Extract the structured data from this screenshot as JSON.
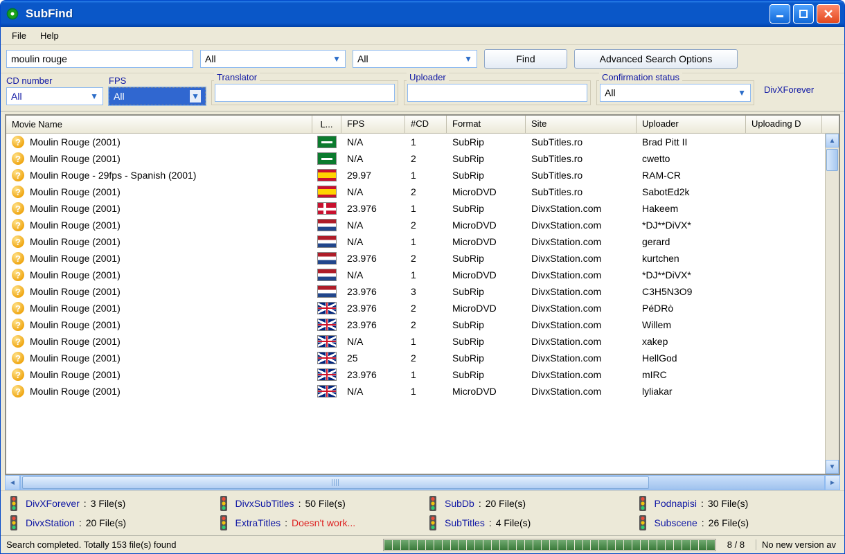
{
  "window": {
    "title": "SubFind"
  },
  "menu": {
    "file": "File",
    "help": "Help"
  },
  "search": {
    "query": "moulin rouge",
    "lang_combo": "All",
    "second_combo": "All",
    "find_btn": "Find",
    "advanced_btn": "Advanced Search Options"
  },
  "adv": {
    "cd_label": "CD number",
    "cd_value": "All",
    "fps_label": "FPS",
    "fps_value": "All",
    "translator_label": "Translator",
    "translator_value": "",
    "uploader_label": "Uploader",
    "uploader_value": "",
    "confirm_label": "Confirmation status",
    "confirm_value": "All",
    "site_link": "DivXForever"
  },
  "columns": {
    "name": "Movie Name",
    "lang": "L...",
    "fps": "FPS",
    "cd": "#CD",
    "fmt": "Format",
    "site": "Site",
    "uploader": "Uploader",
    "date": "Uploading D"
  },
  "rows": [
    {
      "name": "Moulin Rouge (2001)",
      "flag": "sa",
      "fps": "N/A",
      "cd": "1",
      "fmt": "SubRip",
      "site": "SubTitles.ro",
      "up": "Brad Pitt II"
    },
    {
      "name": "Moulin Rouge (2001)",
      "flag": "sa",
      "fps": "N/A",
      "cd": "2",
      "fmt": "SubRip",
      "site": "SubTitles.ro",
      "up": "cwetto"
    },
    {
      "name": "Moulin Rouge - 29fps - Spanish (2001)",
      "flag": "es",
      "fps": "29.97",
      "cd": "1",
      "fmt": "SubRip",
      "site": "SubTitles.ro",
      "up": "RAM-CR"
    },
    {
      "name": "Moulin Rouge (2001)",
      "flag": "es",
      "fps": "N/A",
      "cd": "2",
      "fmt": "MicroDVD",
      "site": "SubTitles.ro",
      "up": "SabotEd2k"
    },
    {
      "name": "Moulin Rouge (2001)",
      "flag": "dk",
      "fps": "23.976",
      "cd": "1",
      "fmt": "SubRip",
      "site": "DivxStation.com",
      "up": "Hakeem"
    },
    {
      "name": "Moulin Rouge (2001)",
      "flag": "nl",
      "fps": "N/A",
      "cd": "2",
      "fmt": "MicroDVD",
      "site": "DivxStation.com",
      "up": "*DJ**DiVX*"
    },
    {
      "name": "Moulin Rouge (2001)",
      "flag": "nl",
      "fps": "N/A",
      "cd": "1",
      "fmt": "MicroDVD",
      "site": "DivxStation.com",
      "up": "gerard"
    },
    {
      "name": "Moulin Rouge (2001)",
      "flag": "nl",
      "fps": "23.976",
      "cd": "2",
      "fmt": "SubRip",
      "site": "DivxStation.com",
      "up": "kurtchen"
    },
    {
      "name": "Moulin Rouge (2001)",
      "flag": "nl",
      "fps": "N/A",
      "cd": "1",
      "fmt": "MicroDVD",
      "site": "DivxStation.com",
      "up": "*DJ**DiVX*"
    },
    {
      "name": "Moulin Rouge (2001)",
      "flag": "nl",
      "fps": "23.976",
      "cd": "3",
      "fmt": "SubRip",
      "site": "DivxStation.com",
      "up": "C3H5N3O9"
    },
    {
      "name": "Moulin Rouge (2001)",
      "flag": "uk",
      "fps": "23.976",
      "cd": "2",
      "fmt": "MicroDVD",
      "site": "DivxStation.com",
      "up": "PéDRò"
    },
    {
      "name": "Moulin Rouge (2001)",
      "flag": "uk",
      "fps": "23.976",
      "cd": "2",
      "fmt": "SubRip",
      "site": "DivxStation.com",
      "up": "Willem"
    },
    {
      "name": "Moulin Rouge (2001)",
      "flag": "uk",
      "fps": "N/A",
      "cd": "1",
      "fmt": "SubRip",
      "site": "DivxStation.com",
      "up": "xakep"
    },
    {
      "name": "Moulin Rouge (2001)",
      "flag": "uk",
      "fps": "25",
      "cd": "2",
      "fmt": "SubRip",
      "site": "DivxStation.com",
      "up": "HellGod"
    },
    {
      "name": "Moulin Rouge (2001)",
      "flag": "uk",
      "fps": "23.976",
      "cd": "1",
      "fmt": "SubRip",
      "site": "DivxStation.com",
      "up": "mIRC"
    },
    {
      "name": "Moulin Rouge (2001)",
      "flag": "uk",
      "fps": "N/A",
      "cd": "1",
      "fmt": "MicroDVD",
      "site": "DivxStation.com",
      "up": "lyliakar"
    }
  ],
  "sources": [
    {
      "name": "DivXForever",
      "sep": " : ",
      "count": "3 File(s)",
      "err": false
    },
    {
      "name": "DivxSubTitles",
      "sep": " : ",
      "count": "50 File(s)",
      "err": false
    },
    {
      "name": "SubDb",
      "sep": " : ",
      "count": "20 File(s)",
      "err": false
    },
    {
      "name": "Podnapisi",
      "sep": " : ",
      "count": "30 File(s)",
      "err": false
    },
    {
      "name": "DivxStation",
      "sep": " : ",
      "count": "20 File(s)",
      "err": false
    },
    {
      "name": "ExtraTitles",
      "sep": " : ",
      "count": "Doesn't work...",
      "err": true
    },
    {
      "name": "SubTitles",
      "sep": " : ",
      "count": "4 File(s)",
      "err": false
    },
    {
      "name": "Subscene",
      "sep": " : ",
      "count": "26 File(s)",
      "err": false
    }
  ],
  "status": {
    "text": "Search completed. Totally 153 file(s) found",
    "progress": "8 / 8",
    "version": "No new version av"
  }
}
